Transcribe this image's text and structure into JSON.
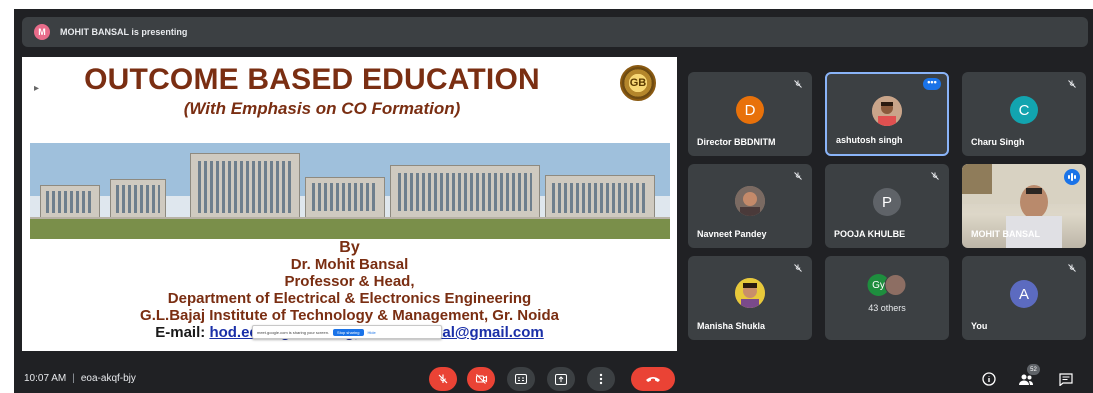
{
  "banner": {
    "avatar_letter": "M",
    "text": "MOHIT BANSAL is presenting"
  },
  "slide": {
    "title": "OUTCOME BASED EDUCATION",
    "subtitle": "(With Emphasis on CO Formation)",
    "by": "By",
    "presenter": "Dr. Mohit Bansal",
    "role": "Professor & Head,",
    "department": "Department of Electrical & Electronics Engineering",
    "institute": "G.L.Bajaj Institute of Technology & Management, Gr. Noida",
    "email_label": "E-mail:",
    "email_1": "hod.eee@glbitm.org,",
    "email_2": "mohit.bansal@gmail.com",
    "share_text": "meet.google.com is sharing your screen.",
    "share_stop": "Stop sharing",
    "share_hide": "Hide"
  },
  "participants": [
    {
      "name": "Director BBDNITM",
      "avatar": "D",
      "color": "#e8710a",
      "muted": true
    },
    {
      "name": "ashutosh singh",
      "avatar": "",
      "color": "",
      "muted": false
    },
    {
      "name": "Charu Singh",
      "avatar": "C",
      "color": "#12a4af",
      "muted": true
    },
    {
      "name": "Navneet Pandey",
      "avatar": "",
      "color": "",
      "muted": true
    },
    {
      "name": "POOJA KHULBE",
      "avatar": "P",
      "color": "#5f6368",
      "muted": true
    },
    {
      "name": "MOHIT BANSAL",
      "avatar": "",
      "color": "",
      "muted": false
    },
    {
      "name": "Manisha Shukla",
      "avatar": "",
      "color": "",
      "muted": true
    },
    {
      "name": "43 others",
      "avatar": "Gy",
      "color": "#1e8e3e",
      "muted": false
    },
    {
      "name": "You",
      "avatar": "A",
      "color": "#5c6bc0",
      "muted": true
    }
  ],
  "bottom": {
    "time": "10:07 AM",
    "meeting_code": "eoa-akqf-bjy",
    "people_count": "52"
  },
  "colors": {
    "leave": "#ea4335",
    "active_border": "#8ab4f8",
    "background": "#202124"
  }
}
